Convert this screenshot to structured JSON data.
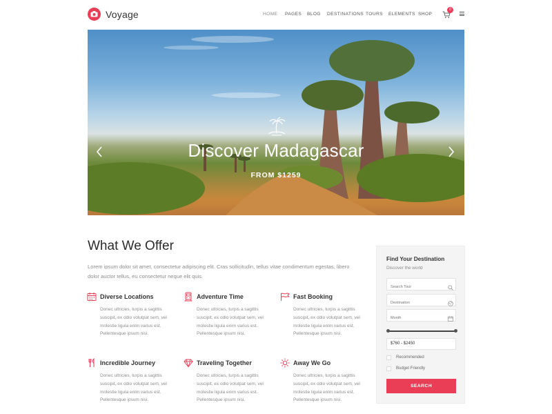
{
  "brand": {
    "name": "Voyage",
    "accent": "#ea3e57"
  },
  "nav": {
    "items": [
      "HOME",
      "PAGES",
      "BLOG",
      "DESTINATIONS",
      "TOURS",
      "ELEMENTS",
      "SHOP"
    ],
    "active": "HOME",
    "cart_count": "0"
  },
  "hero": {
    "title": "Discover Madagascar",
    "subtitle": "FROM $1259",
    "icon": "palm-island-icon"
  },
  "offer": {
    "title": "What We Offer",
    "description": "Lorem ipsum dolor sit amet, consectetur adipiscing elit. Cras sollicitudin, tellus vitae condimentum egestas, libero dolor auctor tellus, eu consectetur neque elit quis.",
    "features": [
      {
        "title": "Diverse Locations",
        "icon": "calendar-icon",
        "text": "Donec ultricies, turpis a sagittis suscipit, ex odio volutpat sem, vel molestie ligula enim varius est. Pellentesque ipsum nisi."
      },
      {
        "title": "Adventure Time",
        "icon": "train-icon",
        "text": "Donec ultricies, turpis a sagittis suscipit, ex odio volutpat sem, vel molestie ligula enim varius est. Pellentesque ipsum nisi."
      },
      {
        "title": "Fast Booking",
        "icon": "flag-icon",
        "text": "Donec ultricies, turpis a sagittis suscipit, ex odio volutpat sem, vel molestie ligula enim varius est. Pellentesque ipsum nisi."
      },
      {
        "title": "Incredible Journey",
        "icon": "cutlery-icon",
        "text": "Donec ultricies, turpis a sagittis suscipit, ex odio volutpat sem, vel molestie ligula enim varius est. Pellentesque ipsum nisi."
      },
      {
        "title": "Traveling Together",
        "icon": "diamond-icon",
        "text": "Donec ultricies, turpis a sagittis suscipit, ex odio volutpat sem, vel molestie ligula enim varius est. Pellentesque ipsum nisi."
      },
      {
        "title": "Away We Go",
        "icon": "sun-icon",
        "text": "Donec ultricies, turpis a sagittis suscipit, ex odio volutpat sem, vel molestie ligula enim varius est. Pellentesque ipsum nisi."
      }
    ]
  },
  "search_widget": {
    "title": "Find Your Destination",
    "subtitle": "Discover the world",
    "search_placeholder": "Search Tour",
    "destination_placeholder": "Destination",
    "month_placeholder": "Month",
    "price_range": "$760 - $2450",
    "options": [
      "Recommended",
      "Budget Friendly"
    ],
    "button": "SEARCH"
  }
}
